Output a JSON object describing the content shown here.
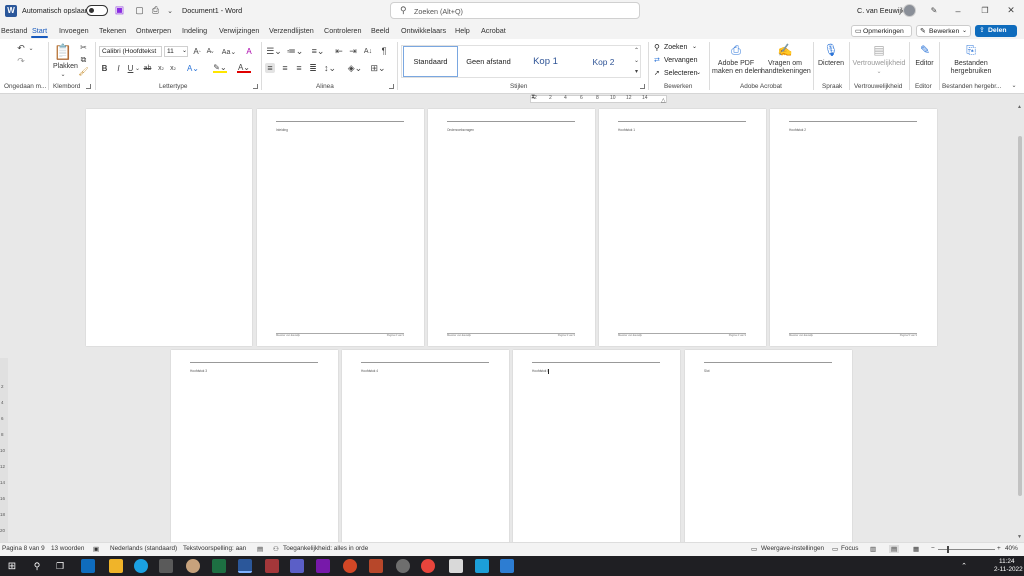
{
  "app": {
    "autosave_label": "Automatisch opslaan",
    "doc_title": "Document1 - Word",
    "search_placeholder": "Zoeken (Alt+Q)",
    "user_name": "C. van Eeuwijk"
  },
  "menu": {
    "items": [
      "Bestand",
      "Start",
      "Invoegen",
      "Tekenen",
      "Ontwerpen",
      "Indeling",
      "Verwijzingen",
      "Verzendlijsten",
      "Controleren",
      "Beeld",
      "Ontwikkelaars",
      "Help",
      "Acrobat"
    ],
    "opmerkingen": "Opmerkingen",
    "bewerken": "Bewerken",
    "delen": "Delen"
  },
  "ribbon": {
    "groups": {
      "undo": "Ongedaan m...",
      "klembord": "Klembord",
      "lettertype": "Lettertype",
      "alinea": "Alinea",
      "stijlen": "Stijlen",
      "bewerken": "Bewerken",
      "acrobat": "Adobe Acrobat",
      "spraak": "Spraak",
      "vertrouwelijkheid": "Vertrouwelijkheid",
      "editor": "Editor",
      "bestanden": "Bestanden hergebr..."
    },
    "plakken": "Plakken",
    "font_name": "Calibri (Hoofdtekst",
    "font_size": "11",
    "styles": [
      "Standaard",
      "Geen afstand",
      "Kop 1",
      "Kop 2"
    ],
    "zoeken": "Zoeken",
    "vervangen": "Vervangen",
    "selecteren": "Selecteren",
    "adobe_pdf_1": "Adobe PDF",
    "adobe_pdf_2": "maken en delen",
    "vragen_1": "Vragen om",
    "vragen_2": "handtekeningen",
    "dicteren": "Dicteren",
    "vertrouwelijkheid_btn": "Vertrouwelijkheid",
    "editor_btn": "Editor",
    "bestanden_1": "Bestanden",
    "bestanden_2": "hergebruiken"
  },
  "ruler_ticks": [
    "2",
    "2",
    "4",
    "6",
    "8",
    "10",
    "12",
    "14"
  ],
  "vruler_ticks": [
    "2",
    "4",
    "6",
    "8",
    "10",
    "12",
    "14",
    "16",
    "18",
    "20"
  ],
  "pages": [
    {
      "header": "",
      "footer_left": "",
      "footer_right": ""
    },
    {
      "header": "Inleiding",
      "footer_left": "Meester van Eeuwijk",
      "footer_right": "Pagina 2 van 9"
    },
    {
      "header": "Onderzoeksvragen",
      "footer_left": "Meester van Eeuwijk",
      "footer_right": "Pagina 3 van 9"
    },
    {
      "header": "Hoofdstuk 1",
      "footer_left": "Meester van Eeuwijk",
      "footer_right": "Pagina 4 van 9"
    },
    {
      "header": "Hoofdstuk 2",
      "footer_left": "Meester van Eeuwijk",
      "footer_right": "Pagina 5 van 9"
    },
    {
      "header": "Hoofdstuk 3",
      "footer_left": "",
      "footer_right": ""
    },
    {
      "header": "Hoofdstuk 4",
      "footer_left": "",
      "footer_right": ""
    },
    {
      "header": "Hoofdstuk 5",
      "footer_left": "",
      "footer_right": ""
    },
    {
      "header": "Slot",
      "footer_left": "",
      "footer_right": ""
    }
  ],
  "status": {
    "page": "Pagina 8 van 9",
    "words": "13 woorden",
    "language": "Nederlands (standaard)",
    "spelling": "Tekstvoorspelling: aan",
    "accessibility": "Toegankelijkheid: alles in orde",
    "display": "Weergave-instellingen",
    "focus": "Focus",
    "zoom": "40%"
  },
  "clock": {
    "time": "11:24",
    "date": "2-11-2022"
  },
  "colors": {
    "accent": "#185abd",
    "word_blue": "#2b579a",
    "share_blue": "#0f6cbd"
  }
}
